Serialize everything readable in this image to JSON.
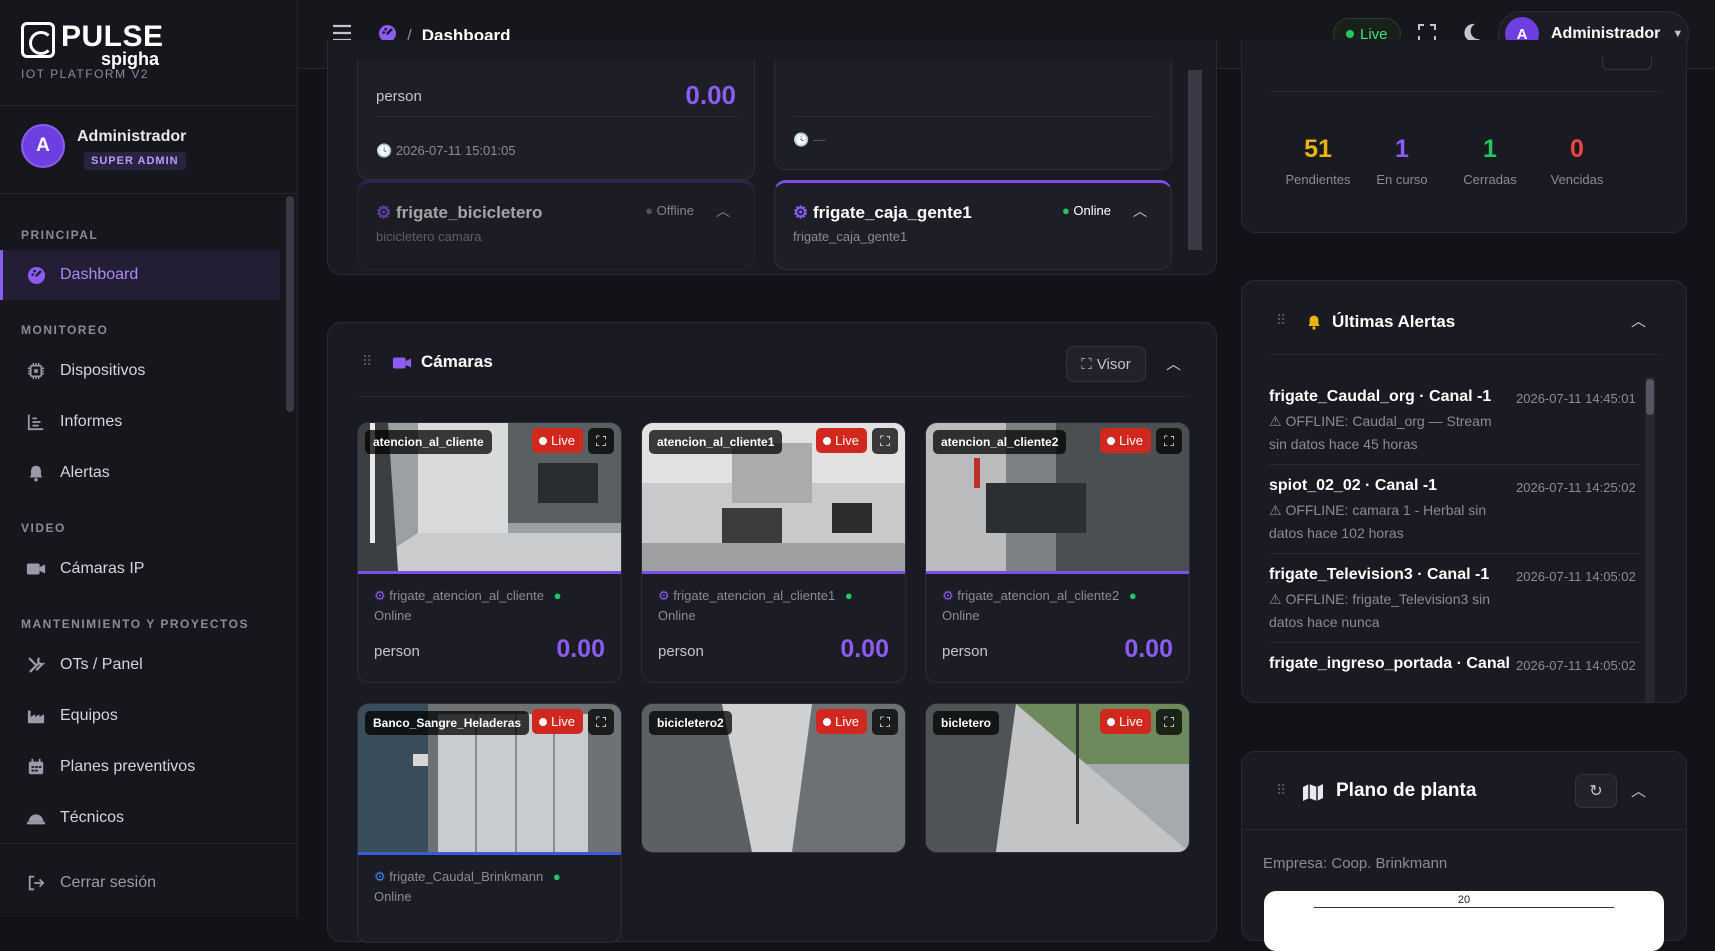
{
  "brand": {
    "name": "PULSE",
    "sub": "spigha",
    "platform": "IOT PLATFORM V2"
  },
  "user": {
    "initial": "A",
    "name": "Administrador",
    "role": "SUPER ADMIN"
  },
  "sidebar": {
    "sections": [
      "PRINCIPAL",
      "MONITOREO",
      "VIDEO",
      "MANTENIMIENTO Y PROYECTOS"
    ],
    "items": [
      {
        "label": "Dashboard",
        "icon": "dashboard-icon"
      },
      {
        "label": "Dispositivos",
        "icon": "chip-icon"
      },
      {
        "label": "Informes",
        "icon": "chart-icon"
      },
      {
        "label": "Alertas",
        "icon": "bell-icon"
      },
      {
        "label": "Cámaras IP",
        "icon": "video-icon"
      },
      {
        "label": "OTs / Panel",
        "icon": "tools-icon"
      },
      {
        "label": "Equipos",
        "icon": "factory-icon"
      },
      {
        "label": "Planes preventivos",
        "icon": "calendar-icon"
      },
      {
        "label": "Técnicos",
        "icon": "helmet-icon"
      }
    ],
    "logout": "Cerrar sesión"
  },
  "topbar": {
    "breadcrumb_sep": "/",
    "page": "Dashboard",
    "live": "Live",
    "user_initial": "A",
    "user_name": "Administrador"
  },
  "devices": {
    "top_left": {
      "metric": "person",
      "value": "0.00",
      "time": "2026-07-11 15:01:05"
    },
    "top_right": {
      "time": "—"
    },
    "bici": {
      "name": "frigate_bicicletero",
      "desc": "bicicletero camara",
      "status": "Offline"
    },
    "caja": {
      "name": "frigate_caja_gente1",
      "desc": "frigate_caja_gente1",
      "status": "Online"
    }
  },
  "cameras": {
    "title": "Cámaras",
    "visor": "Visor",
    "items": [
      {
        "name": "atencion_al_cliente",
        "live": "Live",
        "device": "frigate_atencion_al_cliente",
        "status": "Online",
        "metric": "person",
        "value": "0.00"
      },
      {
        "name": "atencion_al_cliente1",
        "live": "Live",
        "device": "frigate_atencion_al_cliente1",
        "status": "Online",
        "metric": "person",
        "value": "0.00"
      },
      {
        "name": "atencion_al_cliente2",
        "live": "Live",
        "device": "frigate_atencion_al_cliente2",
        "status": "Online",
        "metric": "person",
        "value": "0.00"
      },
      {
        "name": "Banco_Sangre_Heladeras",
        "live": "Live",
        "device": "frigate_Caudal_Brinkmann",
        "status": "Online"
      },
      {
        "name": "bicicletero2",
        "live": "Live"
      },
      {
        "name": "bicletero",
        "live": "Live"
      }
    ]
  },
  "ots": {
    "stats": [
      {
        "value": "51",
        "label": "Pendientes",
        "color": "#eab308"
      },
      {
        "value": "1",
        "label": "En curso",
        "color": "#8b5cf6"
      },
      {
        "value": "1",
        "label": "Cerradas",
        "color": "#22c55e"
      },
      {
        "value": "0",
        "label": "Vencidas",
        "color": "#ef4444"
      }
    ]
  },
  "alerts": {
    "title": "Últimas Alertas",
    "items": [
      {
        "title": "frigate_Caudal_org · Canal -1",
        "time": "2026-07-11 14:45:01",
        "msg": "⚠ OFFLINE: Caudal_org — Stream sin datos hace 45 horas"
      },
      {
        "title": "spiot_02_02 · Canal -1",
        "time": "2026-07-11 14:25:02",
        "msg": "⚠ OFFLINE: camara 1 - Herbal sin datos hace 102 horas"
      },
      {
        "title": "frigate_Television3 · Canal -1",
        "time": "2026-07-11 14:05:02",
        "msg": "⚠ OFFLINE: frigate_Television3 sin datos hace nunca"
      },
      {
        "title": "frigate_ingreso_portada · Canal",
        "time": "2026-07-11 14:05:02",
        "msg": ""
      }
    ]
  },
  "plano": {
    "title": "Plano de planta",
    "company": "Empresa: Coop. Brinkmann",
    "scale": "20"
  }
}
